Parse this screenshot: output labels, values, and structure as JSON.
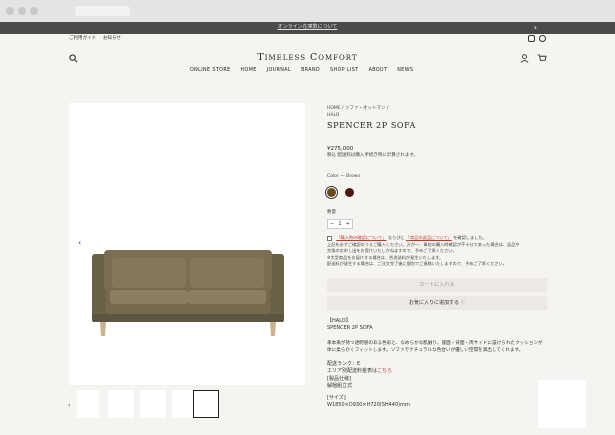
{
  "announcement": {
    "text": "オンライン在庫数について",
    "arrow": "›"
  },
  "utility_links": [
    "ご利用ガイド",
    "お知らせ"
  ],
  "header": {
    "logo": "Timeless Comfort"
  },
  "nav": [
    "ONLINE STORE",
    "HOME",
    "JOURNAL",
    "BRAND",
    "SHOP LIST",
    "ABOUT",
    "NEWS"
  ],
  "product": {
    "breadcrumb": "HOME / ソファ・オットマン /",
    "brand": "HALO",
    "title": "SPENCER 2P SOFA",
    "price": "¥275,000",
    "tax_note": "税込 配送料は購入手続き時に計算されます。",
    "color_label": "Color",
    "color_value": "Brown",
    "swatches": [
      "#6b4a1e",
      "#4a1a12"
    ],
    "qty_label": "数量",
    "qty_minus": "−",
    "qty_value": "1",
    "qty_plus": "+",
    "consent_link1": "「購入時の確認について」",
    "consent_mid": " ならびに ",
    "consent_link2": "「商品の返品について」",
    "consent_end": " を確認しました。",
    "notice_1": "上記を必ずご確認のうえご購入ください。万が一、事前の購入時確認が不十分であった場合は、返品や",
    "notice_2": "交換のお申し出をお受けいたしかねますので、予めご了承ください。",
    "notice_3": "※大型商品をお届けする場合は、別途送料が発生いたします。",
    "notice_4": "配送料が発生する場合は、ご注文完了後に個別でご連絡いたしますので、予めご了承ください。",
    "add_to_cart": "カートに入れる",
    "add_fav": "お気に入りに追加する ♡",
    "desc_brand": "【HALO】",
    "desc_name": "SPENCER 2P SOFA",
    "desc_1": "革本来が持つ透明感のある色彩と、なめらかな肌触り。座面・背面・両サイドに設けられたクッションが",
    "desc_2": "体に柔らかくフィットします。ソファでナチュラルな色合いが優しい空間を演出してくれます。",
    "delivery_rank": "配送ランク：E",
    "delivery_area": "エリア別配送料金表は",
    "delivery_link": "こちら",
    "material_label": "[製品仕様]",
    "material": "解梱組立式",
    "size_label": "[サイズ]",
    "size": "W1850×D930×H720(SH440)mm"
  },
  "gallery": {
    "prev": "‹",
    "thumb_prev": "‹"
  }
}
